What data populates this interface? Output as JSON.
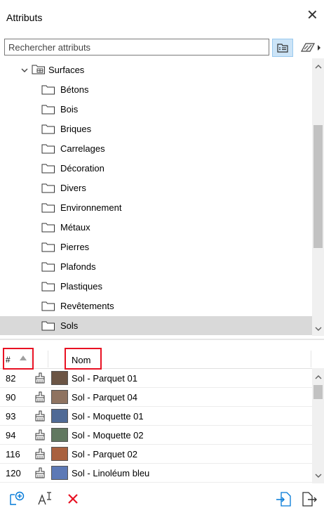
{
  "window": {
    "title": "Attributs",
    "close_glyph": "✕"
  },
  "search": {
    "placeholder": "Rechercher attributs"
  },
  "icons": {
    "view": "list-view-icon",
    "filter": "filter-icon",
    "folder": "folder-icon",
    "surfaces": "surfaces-folder-icon",
    "brush": "brush-icon"
  },
  "tree": {
    "root": {
      "label": "Surfaces",
      "expanded": true
    },
    "folders": [
      {
        "label": "Bétons"
      },
      {
        "label": "Bois"
      },
      {
        "label": "Briques"
      },
      {
        "label": "Carrelages"
      },
      {
        "label": "Décoration"
      },
      {
        "label": "Divers"
      },
      {
        "label": "Environnement"
      },
      {
        "label": "Métaux"
      },
      {
        "label": "Pierres"
      },
      {
        "label": "Plafonds"
      },
      {
        "label": "Plastiques"
      },
      {
        "label": "Revêtements"
      },
      {
        "label": "Sols",
        "selected": true
      }
    ]
  },
  "list": {
    "header": {
      "num": "#",
      "name": "Nom"
    },
    "rows": [
      {
        "num": "82",
        "name": "Sol - Parquet 01",
        "color": "#6b5545"
      },
      {
        "num": "90",
        "name": "Sol - Parquet 04",
        "color": "#8f7360"
      },
      {
        "num": "93",
        "name": "Sol - Moquette 01",
        "color": "#4f6a96"
      },
      {
        "num": "94",
        "name": "Sol - Moquette 02",
        "color": "#617860"
      },
      {
        "num": "116",
        "name": "Sol - Parquet 02",
        "color": "#a9613f"
      },
      {
        "num": "120",
        "name": "Sol - Linoléum bleu",
        "color": "#5c79b6"
      }
    ]
  },
  "toolbar": {
    "new": "new-attribute-icon",
    "rename": "rename-icon",
    "delete": "delete-icon",
    "import": "import-icon",
    "export": "export-icon"
  },
  "colors": {
    "selection": "#d9d9d9",
    "highlight_border": "#e81123",
    "accent": "#0078d7",
    "delete": "#e81123"
  }
}
